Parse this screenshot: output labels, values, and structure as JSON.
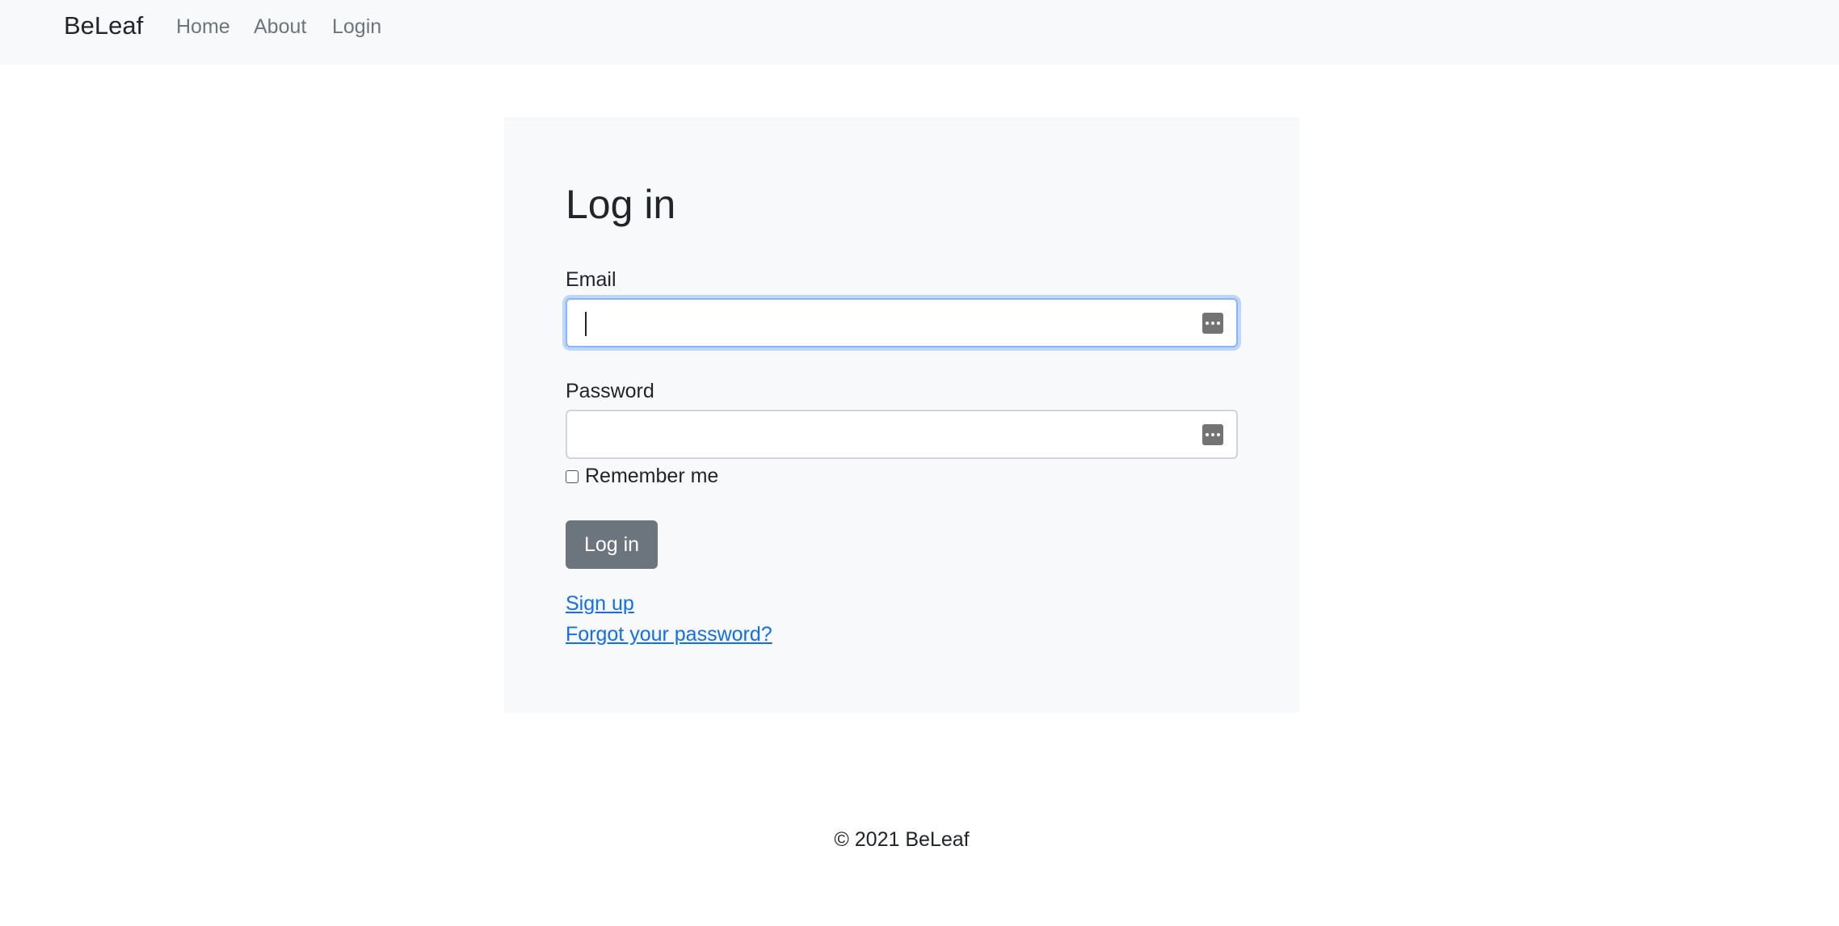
{
  "navbar": {
    "brand": "BeLeaf",
    "links": [
      {
        "label": "Home"
      },
      {
        "label": "About"
      },
      {
        "label": "Login"
      }
    ]
  },
  "login_form": {
    "title": "Log in",
    "email": {
      "label": "Email",
      "value": "",
      "focused": true,
      "icon": "password-manager-icon"
    },
    "password": {
      "label": "Password",
      "value": "",
      "icon": "password-manager-icon"
    },
    "remember_me": {
      "label": "Remember me",
      "checked": false
    },
    "submit_label": "Log in",
    "links": {
      "sign_up": "Sign up",
      "forgot_password": "Forgot your password?"
    }
  },
  "footer": {
    "text": "© 2021 BeLeaf"
  },
  "colors": {
    "navbar_bg": "#f8f9fa",
    "card_bg": "#f8f9fa",
    "button_bg": "#6c757d",
    "link": "#0d6efd",
    "focus_ring": "#86b7fe",
    "nav_link": "#6c757d"
  }
}
